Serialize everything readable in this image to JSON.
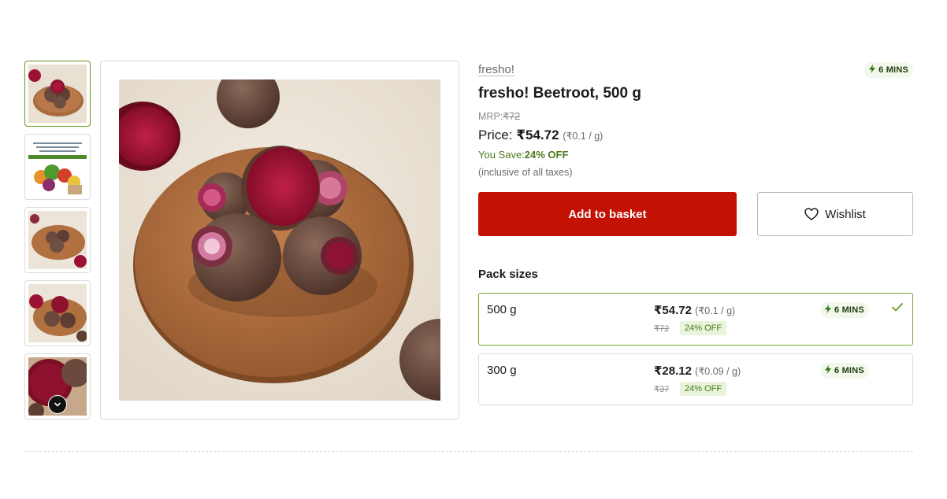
{
  "thumbnails": [
    {
      "label": ""
    },
    {
      "label": "",
      "caption": "By nature, these products come with slight variations in shape, colour and size. This image is for illustration only."
    },
    {
      "label": ""
    },
    {
      "label": ""
    },
    {
      "label": ""
    }
  ],
  "product": {
    "brand": "fresho!",
    "title": "fresho! Beetroot, 500 g",
    "mrp_label": "MRP:",
    "mrp_value": "₹72",
    "price_label": "Price: ",
    "price_value": "₹54.72",
    "price_per_unit": "(₹0.1 / g)",
    "save_label": "You Save:",
    "save_value": "24% OFF",
    "tax_note": "(inclusive of all taxes)",
    "delivery_eta": "6 MINS"
  },
  "actions": {
    "add_to_basket": "Add to basket",
    "wishlist": "Wishlist"
  },
  "pack_sizes": {
    "title": "Pack sizes",
    "items": [
      {
        "size": "500 g",
        "price": "₹54.72",
        "per_unit": "(₹0.1 / g)",
        "mrp": "₹72",
        "off": "24% OFF",
        "eta": "6 MINS",
        "selected": true
      },
      {
        "size": "300 g",
        "price": "₹28.12",
        "per_unit": "(₹0.09 / g)",
        "mrp": "₹37",
        "off": "24% OFF",
        "eta": "6 MINS",
        "selected": false
      }
    ]
  },
  "colors": {
    "accent_red": "#c31103",
    "selected_green": "#7aa82a",
    "save_green": "#4b7a1a"
  }
}
